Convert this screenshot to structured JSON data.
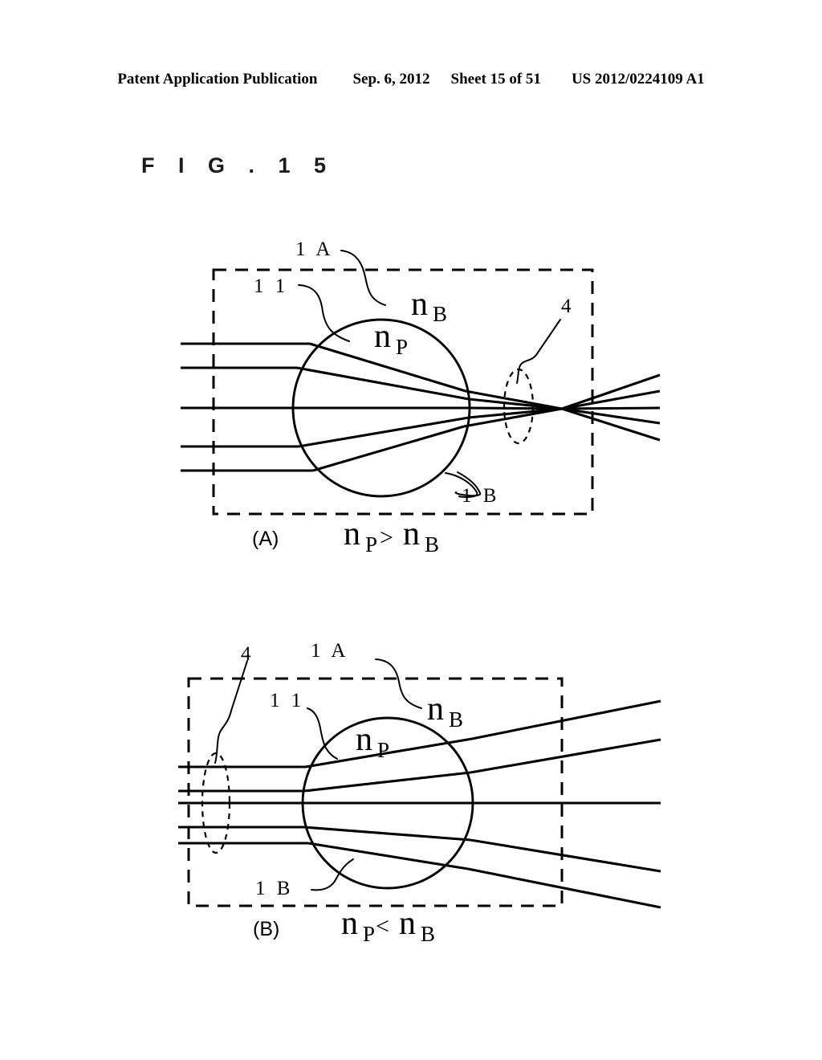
{
  "header": {
    "publication": "Patent Application Publication",
    "date": "Sep. 6, 2012",
    "sheet": "Sheet 15 of 51",
    "number": "US 2012/0224109 A1"
  },
  "figure": {
    "title": "F I G .  1 5"
  },
  "panels": [
    {
      "id": "A",
      "caption": "(A)",
      "relation_n": "n",
      "relation_sub1": "P",
      "relation_op": ">",
      "relation_n2": "n",
      "relation_sub2": "B",
      "labels": {
        "medium_outer": "1 A",
        "particle": "1 1",
        "particle_boundary": "1 B",
        "focus_region": "4",
        "index_background": "n",
        "index_background_sub": "B",
        "index_particle": "n",
        "index_particle_sub": "P"
      }
    },
    {
      "id": "B",
      "caption": "(B)",
      "relation_n": "n",
      "relation_sub1": "P",
      "relation_op": "<",
      "relation_n2": "n",
      "relation_sub2": "B",
      "labels": {
        "medium_outer": "1 A",
        "particle": "1 1",
        "particle_boundary": "1 B",
        "focus_region": "4",
        "index_background": "n",
        "index_background_sub": "B",
        "index_particle": "n",
        "index_particle_sub": "P"
      }
    }
  ],
  "colors": {
    "ink": "#000000",
    "paper": "#ffffff"
  }
}
